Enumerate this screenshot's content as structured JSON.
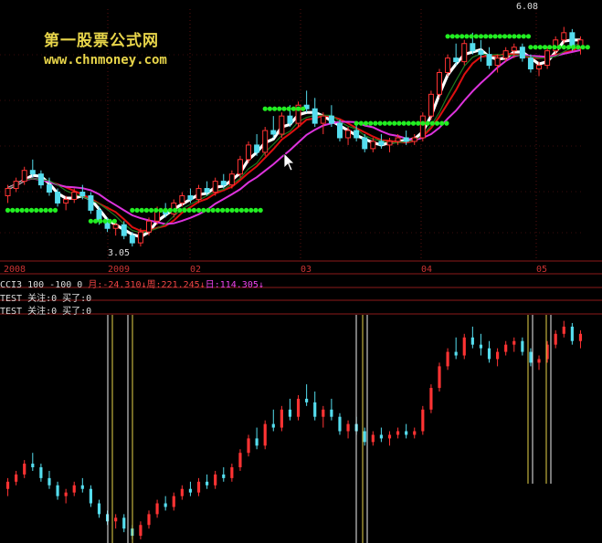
{
  "watermark": {
    "cn": "第一股票公式网",
    "url": "www.chnmoney.com"
  },
  "price_labels": {
    "high": "6.08",
    "low": "3.05"
  },
  "x_axis": [
    "2008",
    "2009",
    "02",
    "03",
    "04",
    "05"
  ],
  "indicators": {
    "cci": {
      "prefix": "CCI3 100 -100 0 ",
      "month": "月:-24.310↓",
      "week": "周:221.245↓",
      "day": "日:114.305↓"
    },
    "test1": "TEST 关注:0 买了:0",
    "test2": "TEST 关注:0 买了:0"
  },
  "colors": {
    "up": "#ff3333",
    "down": "#55ddee",
    "signal": "#22ee22",
    "ma_white": "#ffffff",
    "ma_red": "#dd1010",
    "ma_magenta": "#dd33dd",
    "ma_green": "#1e7a1e"
  },
  "chart_data": {
    "type": "candlestick",
    "ohlc": [
      [
        3.75,
        3.9,
        3.65,
        3.85
      ],
      [
        3.85,
        4.0,
        3.8,
        3.95
      ],
      [
        3.95,
        4.15,
        3.9,
        4.1
      ],
      [
        4.1,
        4.25,
        4.0,
        4.05
      ],
      [
        4.05,
        4.1,
        3.85,
        3.9
      ],
      [
        3.9,
        4.0,
        3.75,
        3.8
      ],
      [
        3.8,
        3.85,
        3.6,
        3.65
      ],
      [
        3.65,
        3.75,
        3.55,
        3.7
      ],
      [
        3.7,
        3.85,
        3.65,
        3.8
      ],
      [
        3.8,
        3.9,
        3.7,
        3.75
      ],
      [
        3.75,
        3.8,
        3.5,
        3.55
      ],
      [
        3.55,
        3.6,
        3.35,
        3.4
      ],
      [
        3.4,
        3.45,
        3.25,
        3.3
      ],
      [
        3.3,
        3.4,
        3.2,
        3.35
      ],
      [
        3.35,
        3.4,
        3.15,
        3.2
      ],
      [
        3.2,
        3.25,
        3.05,
        3.1
      ],
      [
        3.1,
        3.3,
        3.05,
        3.25
      ],
      [
        3.25,
        3.45,
        3.2,
        3.4
      ],
      [
        3.4,
        3.6,
        3.35,
        3.55
      ],
      [
        3.55,
        3.65,
        3.45,
        3.5
      ],
      [
        3.5,
        3.7,
        3.45,
        3.65
      ],
      [
        3.65,
        3.8,
        3.6,
        3.75
      ],
      [
        3.75,
        3.85,
        3.65,
        3.7
      ],
      [
        3.7,
        3.9,
        3.65,
        3.85
      ],
      [
        3.85,
        3.95,
        3.75,
        3.8
      ],
      [
        3.8,
        4.0,
        3.75,
        3.95
      ],
      [
        3.95,
        4.05,
        3.85,
        3.9
      ],
      [
        3.9,
        4.1,
        3.85,
        4.05
      ],
      [
        4.05,
        4.3,
        4.0,
        4.25
      ],
      [
        4.25,
        4.5,
        4.2,
        4.45
      ],
      [
        4.45,
        4.6,
        4.3,
        4.35
      ],
      [
        4.35,
        4.7,
        4.3,
        4.65
      ],
      [
        4.65,
        4.85,
        4.55,
        4.6
      ],
      [
        4.6,
        4.9,
        4.55,
        4.85
      ],
      [
        4.85,
        5.0,
        4.7,
        4.75
      ],
      [
        4.75,
        5.05,
        4.7,
        5.0
      ],
      [
        5.0,
        5.2,
        4.9,
        4.95
      ],
      [
        4.95,
        5.1,
        4.7,
        4.75
      ],
      [
        4.75,
        4.9,
        4.6,
        4.85
      ],
      [
        4.85,
        5.0,
        4.7,
        4.75
      ],
      [
        4.75,
        4.8,
        4.5,
        4.55
      ],
      [
        4.55,
        4.7,
        4.45,
        4.65
      ],
      [
        4.65,
        4.75,
        4.5,
        4.55
      ],
      [
        4.55,
        4.6,
        4.35,
        4.4
      ],
      [
        4.4,
        4.55,
        4.35,
        4.5
      ],
      [
        4.5,
        4.6,
        4.4,
        4.45
      ],
      [
        4.45,
        4.55,
        4.35,
        4.5
      ],
      [
        4.5,
        4.6,
        4.45,
        4.55
      ],
      [
        4.55,
        4.65,
        4.45,
        4.5
      ],
      [
        4.5,
        4.6,
        4.45,
        4.55
      ],
      [
        4.55,
        4.9,
        4.5,
        4.85
      ],
      [
        4.85,
        5.2,
        4.8,
        5.15
      ],
      [
        5.15,
        5.5,
        5.1,
        5.45
      ],
      [
        5.45,
        5.7,
        5.4,
        5.65
      ],
      [
        5.65,
        5.85,
        5.55,
        5.6
      ],
      [
        5.6,
        5.9,
        5.55,
        5.85
      ],
      [
        5.85,
        6.0,
        5.7,
        5.75
      ],
      [
        5.75,
        5.9,
        5.6,
        5.7
      ],
      [
        5.7,
        5.8,
        5.5,
        5.55
      ],
      [
        5.55,
        5.7,
        5.45,
        5.65
      ],
      [
        5.65,
        5.8,
        5.6,
        5.75
      ],
      [
        5.75,
        5.85,
        5.65,
        5.8
      ],
      [
        5.8,
        5.85,
        5.6,
        5.65
      ],
      [
        5.65,
        5.7,
        5.45,
        5.5
      ],
      [
        5.5,
        5.6,
        5.4,
        5.55
      ],
      [
        5.55,
        5.8,
        5.5,
        5.75
      ],
      [
        5.75,
        5.95,
        5.7,
        5.9
      ],
      [
        5.9,
        6.08,
        5.85,
        6.0
      ],
      [
        6.0,
        6.05,
        5.75,
        5.8
      ],
      [
        5.8,
        5.95,
        5.7,
        5.9
      ]
    ]
  }
}
